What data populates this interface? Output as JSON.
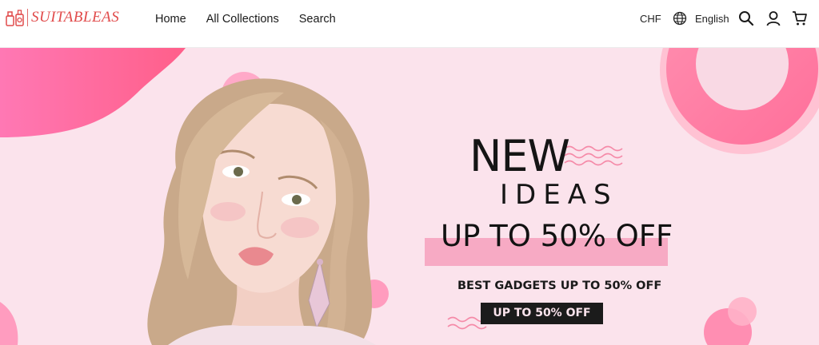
{
  "brand": {
    "name": "SUITABLEAS"
  },
  "nav": {
    "items": [
      {
        "label": "Home"
      },
      {
        "label": "All Collections"
      },
      {
        "label": "Search"
      }
    ]
  },
  "header": {
    "currency": "CHF",
    "language": "English",
    "icons": [
      "globe-icon",
      "search-icon",
      "account-icon",
      "cart-icon"
    ]
  },
  "hero": {
    "headline_line1": "NEW",
    "headline_line2": "IDEAS",
    "promo": "UP TO 50% OFF",
    "subheading": "BEST GADGETS UP TO 50% OFF",
    "cta_label": "UP TO 50% OFF",
    "colors": {
      "background": "#fbe3ec",
      "accent_pink": "#f7aac4",
      "hot_pink": "#ff6f9e",
      "dark": "#1b1b1b",
      "brand_red": "#e14b4b"
    }
  }
}
